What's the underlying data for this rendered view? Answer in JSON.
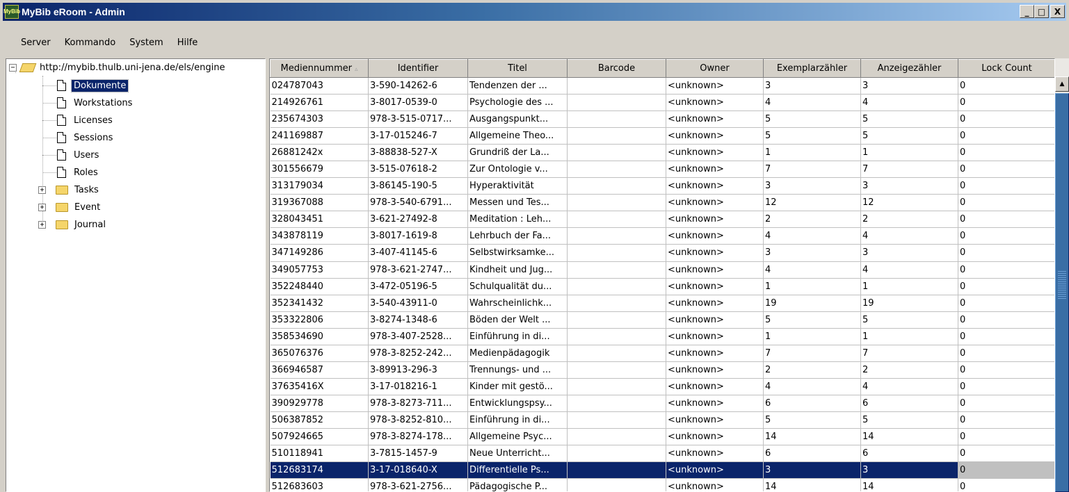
{
  "window": {
    "title": "MyBib eRoom - Admin",
    "app_icon_text": "MyBib",
    "minimize_label": "_",
    "maximize_label": "□",
    "close_label": "X"
  },
  "menu": [
    "Server",
    "Kommando",
    "System",
    "Hilfe"
  ],
  "tree": {
    "root": "http://mybib.thulb.uni-jena.de/els/engine",
    "items": [
      {
        "label": "Dokumente",
        "type": "doc",
        "selected": true
      },
      {
        "label": "Workstations",
        "type": "doc"
      },
      {
        "label": "Licenses",
        "type": "doc"
      },
      {
        "label": "Sessions",
        "type": "doc"
      },
      {
        "label": "Users",
        "type": "doc"
      },
      {
        "label": "Roles",
        "type": "doc"
      },
      {
        "label": "Tasks",
        "type": "folder"
      },
      {
        "label": "Event",
        "type": "folder"
      },
      {
        "label": "Journal",
        "type": "folder"
      }
    ],
    "expand_symbol": "+",
    "collapse_symbol": "−"
  },
  "grid": {
    "sort_indicator": "▵",
    "columns": [
      "Mediennummer",
      "Identifier",
      "Titel",
      "Barcode",
      "Owner",
      "Exemplarzähler",
      "Anzeigezähler",
      "Lock Count"
    ],
    "rows": [
      [
        "024787043",
        "3-590-14262-6",
        "Tendenzen der ...",
        "",
        "<unknown>",
        "3",
        "3",
        "0"
      ],
      [
        "214926761",
        "3-8017-0539-0",
        "Psychologie des ...",
        "",
        "<unknown>",
        "4",
        "4",
        "0"
      ],
      [
        "235674303",
        "978-3-515-0717...",
        "Ausgangspunkt...",
        "",
        "<unknown>",
        "5",
        "5",
        "0"
      ],
      [
        "241169887",
        "3-17-015246-7",
        "Allgemeine Theo...",
        "",
        "<unknown>",
        "5",
        "5",
        "0"
      ],
      [
        "26881242x",
        "3-88838-527-X",
        "Grundriß der La...",
        "",
        "<unknown>",
        "1",
        "1",
        "0"
      ],
      [
        "301556679",
        "3-515-07618-2",
        "Zur Ontologie v...",
        "",
        "<unknown>",
        "7",
        "7",
        "0"
      ],
      [
        "313179034",
        "3-86145-190-5",
        "Hyperaktivität",
        "",
        "<unknown>",
        "3",
        "3",
        "0"
      ],
      [
        "319367088",
        "978-3-540-6791...",
        "Messen und Tes...",
        "",
        "<unknown>",
        "12",
        "12",
        "0"
      ],
      [
        "328043451",
        "3-621-27492-8",
        "Meditation : Leh...",
        "",
        "<unknown>",
        "2",
        "2",
        "0"
      ],
      [
        "343878119",
        "3-8017-1619-8",
        "Lehrbuch der Fa...",
        "",
        "<unknown>",
        "4",
        "4",
        "0"
      ],
      [
        "347149286",
        "3-407-41145-6",
        "Selbstwirksamke...",
        "",
        "<unknown>",
        "3",
        "3",
        "0"
      ],
      [
        "349057753",
        "978-3-621-2747...",
        "Kindheit und Jug...",
        "",
        "<unknown>",
        "4",
        "4",
        "0"
      ],
      [
        "352248440",
        "3-472-05196-5",
        "Schulqualität du...",
        "",
        "<unknown>",
        "1",
        "1",
        "0"
      ],
      [
        "352341432",
        "3-540-43911-0",
        "Wahrscheinlichk...",
        "",
        "<unknown>",
        "19",
        "19",
        "0"
      ],
      [
        "353322806",
        "3-8274-1348-6",
        "Böden der Welt ...",
        "",
        "<unknown>",
        "5",
        "5",
        "0"
      ],
      [
        "358534690",
        "978-3-407-2528...",
        "Einführung in di...",
        "",
        "<unknown>",
        "1",
        "1",
        "0"
      ],
      [
        "365076376",
        "978-3-8252-242...",
        "Medienpädagogik",
        "",
        "<unknown>",
        "7",
        "7",
        "0"
      ],
      [
        "366946587",
        "3-89913-296-3",
        "Trennungs- und ...",
        "",
        "<unknown>",
        "2",
        "2",
        "0"
      ],
      [
        "37635416X",
        "3-17-018216-1",
        "Kinder mit gestö...",
        "",
        "<unknown>",
        "4",
        "4",
        "0"
      ],
      [
        "390929778",
        "978-3-8273-711...",
        "Entwicklungspsy...",
        "",
        "<unknown>",
        "6",
        "6",
        "0"
      ],
      [
        "506387852",
        "978-3-8252-810...",
        "Einführung in di...",
        "",
        "<unknown>",
        "5",
        "5",
        "0"
      ],
      [
        "507924665",
        "978-3-8274-178...",
        "Allgemeine Psyc...",
        "",
        "<unknown>",
        "14",
        "14",
        "0"
      ],
      [
        "510118941",
        "3-7815-1457-9",
        "Neue Unterricht...",
        "",
        "<unknown>",
        "6",
        "6",
        "0"
      ],
      [
        "512683174",
        "3-17-018640-X",
        "Differentielle Ps...",
        "",
        "<unknown>",
        "3",
        "3",
        "0"
      ],
      [
        "512683603",
        "978-3-621-2756...",
        "Pädagogische P...",
        "",
        "<unknown>",
        "14",
        "14",
        "0"
      ]
    ],
    "selected_row": 23,
    "scroll_up_symbol": "▲"
  }
}
